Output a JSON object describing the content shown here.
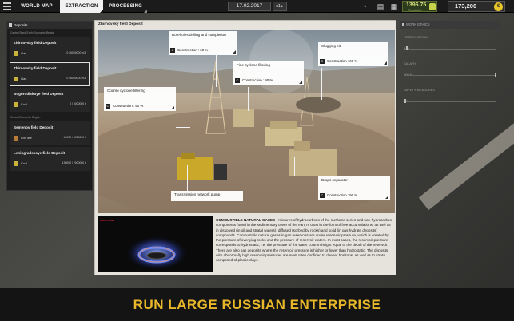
{
  "topbar": {
    "tabs": [
      {
        "label": "WORLD MAP"
      },
      {
        "label": "EXTRACTION"
      },
      {
        "label": "PROCESSING"
      }
    ],
    "date": "17.02.2017",
    "speed": "x1 ▸",
    "reputation": {
      "value": "1396.75",
      "label": "Reputation"
    },
    "money": "173,200",
    "coin_symbol": "€"
  },
  "deposits": {
    "header": "Deposits",
    "regions": [
      {
        "name": "Central Black Earth Economic Region",
        "items": [
          {
            "name": "Zhirnovsky field Deposit",
            "resource": "Gas",
            "amount": "0 / 6000000 m3",
            "selected": false
          },
          {
            "name": "Zhirnovsky field Deposit",
            "resource": "Gas",
            "amount": "0 / 6000000 m3",
            "selected": true
          },
          {
            "name": "Bogorodiskoye field Deposit",
            "resource": "Coal",
            "amount": "0 / 6000000 t",
            "selected": false
          }
        ]
      },
      {
        "name": "Central Economic Region",
        "items": [
          {
            "name": "Semenov field Deposit",
            "resource": "Iron ore",
            "amount": "40000 / 6000000 t",
            "selected": false
          },
          {
            "name": "Leningradskoye field Deposit",
            "resource": "Coal",
            "amount": "130000 / 2000000 t",
            "selected": false
          }
        ]
      }
    ]
  },
  "main": {
    "title": "Zhirnovsky field Deposit",
    "callouts": [
      {
        "title": "Boreholes drilling and completion",
        "status": "Construction : 60 %"
      },
      {
        "title": "Slugging pit",
        "status": "Construction : 60 %"
      },
      {
        "title": "Fine cyclone filtering",
        "status": "Construction : 90 %"
      },
      {
        "title": "Coarse cyclone filtering",
        "status": "Construction : 90 %"
      },
      {
        "title": "Transmission network pump",
        "status": ""
      },
      {
        "title": "Drops separator",
        "status": "Construction : 90 %"
      }
    ],
    "image_label": "GAS FLAME",
    "description_title": "COMBUSTIBLE NATURAL GASES",
    "description": " - mixtures of hydrocarbons of the methane series and non-hydrocarbon components found in the sedimentary cover of the earth's crust in the form of free accumulations, as well as in dissolved (in oil and stratal waters), diffused (sorbed by rocks) and solid (in gas hydrate deposits) compounds. Combustible natural gases in gas reservoirs are under reservoir pressure, which is created by the pressure of overlying rocks and the pressure of reservoir waters. In most cases, the reservoir pressure corresponds to hydrostatic, i.e. the pressure of the water column height equal to the depth of the reservoir. There are also gas deposits where the reservoir pressure is higher or lower than hydrostatic. The deposits with abnormally high reservoir pressures are most often confined to deeper horizons, as well as to strata composed of plastic clays."
  },
  "work_ethics": {
    "header": "WORK ETHICS",
    "items": [
      {
        "label": "DEPRECIATION",
        "value": "3 %",
        "level": 0.03
      },
      {
        "label": "SALARY",
        "value": "100 %",
        "level": 1.0
      },
      {
        "label": "SAFETY MEASURES",
        "value": "1 %",
        "level": 0.01
      }
    ]
  },
  "banner": {
    "text": "RUN LARGE RUSSIAN ENTERPRISE"
  },
  "colors": {
    "accent": "#e8b82a",
    "reputation": "#c6d24a",
    "coin": "#e8c52a"
  }
}
